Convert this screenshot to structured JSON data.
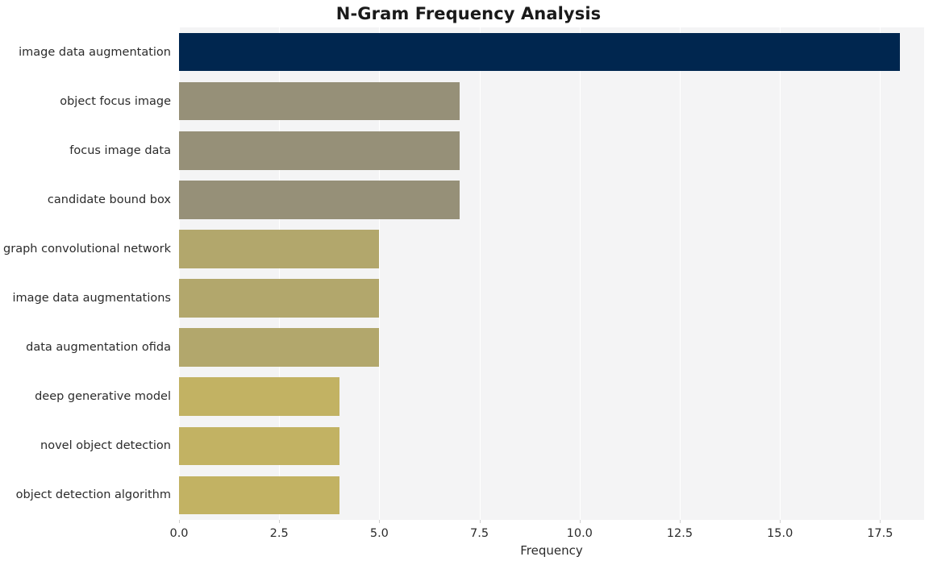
{
  "chart_data": {
    "type": "bar",
    "orientation": "horizontal",
    "title": "N-Gram Frequency Analysis",
    "xlabel": "Frequency",
    "ylabel": "",
    "categories": [
      "image data augmentation",
      "object focus image",
      "focus image data",
      "candidate bound box",
      "graph convolutional network",
      "image data augmentations",
      "data augmentation ofida",
      "deep generative model",
      "novel object detection",
      "object detection algorithm"
    ],
    "values": [
      18,
      7,
      7,
      7,
      5,
      5,
      5,
      4,
      4,
      4
    ],
    "bar_colors": [
      "#00264f",
      "#969078",
      "#969078",
      "#969078",
      "#b2a76c",
      "#b2a76c",
      "#b2a76c",
      "#c2b263",
      "#c2b263",
      "#c2b263"
    ],
    "xlim": [
      0,
      18.6
    ],
    "xticks": [
      0,
      2.5,
      5,
      7.5,
      10,
      12.5,
      15,
      17.5
    ],
    "xticklabels": [
      "0.0",
      "2.5",
      "5.0",
      "7.5",
      "10.0",
      "12.5",
      "15.0",
      "17.5"
    ],
    "grid": true,
    "grid_axis": "x",
    "grid_color": "#ffffff",
    "plot_background": "#f4f4f5",
    "figure_background": "#ffffff",
    "legend": null
  }
}
